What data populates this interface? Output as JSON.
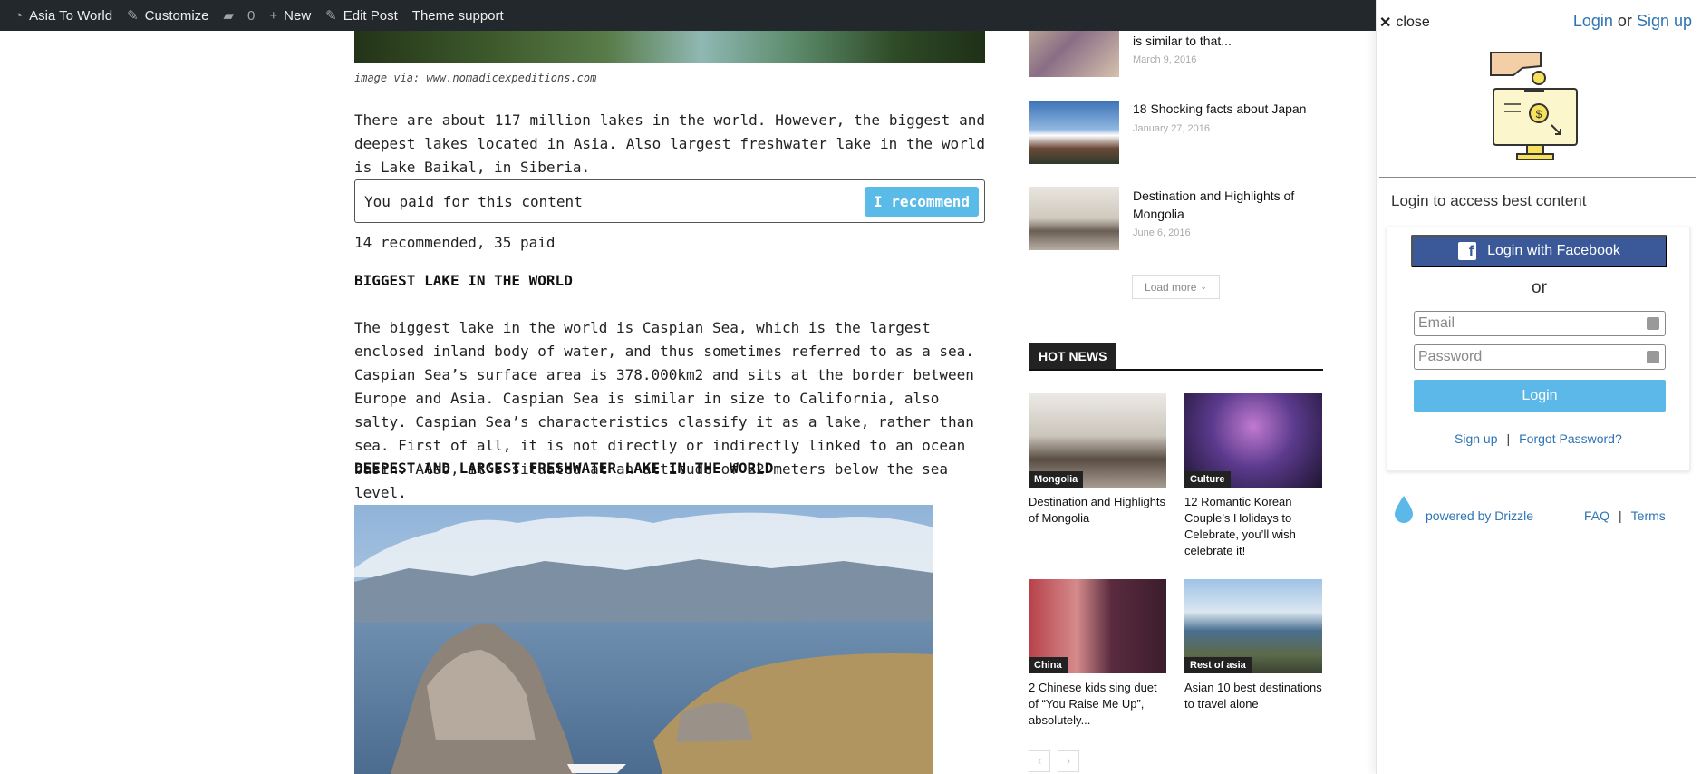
{
  "adminbar": {
    "site": "Asia To World",
    "customize": "Customize",
    "comments_count": "0",
    "new": "New",
    "edit_post": "Edit Post",
    "theme_support": "Theme support",
    "bg_color": "#23282d"
  },
  "article": {
    "image_caption": "image via: www.nomadicexpeditions.com",
    "intro": "There are about 117 million lakes in the world. However, the biggest and deepest lakes located in Asia. Also largest freshwater lake in the world is Lake Baikal, in Siberia.",
    "paywall_text": "You paid for this content",
    "recommend_button": "I recommend",
    "stats": "14 recommended, 35 paid",
    "heading_1": "BIGGEST LAKE IN THE WORLD",
    "paragraph_2": "The biggest lake in the world is Caspian Sea, which is the largest enclosed inland body of water, and thus sometimes referred to as a sea. Caspian Sea’s surface area is 378.000km2 and sits at the border between Europe and Asia. Caspian Sea is similar in size to California, also salty. Caspian Sea’s characteristics classify it as a lake, rather than sea. First of all, it is not directly or indirectly linked to an ocean basin. Also, it’s situated at an altitude of 22 meters below the sea level.",
    "heading_2": "DEEPEST AND LARGEST FRESHWATER LAKE IN THE WORLD",
    "accent_color": "#5bbbe8"
  },
  "sidebar": {
    "recent": [
      {
        "title": "is similar to that...",
        "date": "March 9, 2016"
      },
      {
        "title": "18 Shocking facts about Japan",
        "date": "January 27, 2016"
      },
      {
        "title": "Destination and Highlights of Mongolia",
        "date": "June 6, 2016"
      }
    ],
    "load_more": "Load more",
    "hot_news_label": "HOT NEWS",
    "cards": [
      {
        "category": "Mongolia",
        "title": "Destination and Highlights of Mongolia"
      },
      {
        "category": "Culture",
        "title": "12 Romantic Korean Couple’s Holidays to Celebrate, you’ll wish celebrate it!"
      },
      {
        "category": "China",
        "title": "2 Chinese kids sing duet of “You Raise Me Up”, absolutely..."
      },
      {
        "category": "Rest of asia",
        "title": "Asian 10 best destinations to travel alone"
      }
    ],
    "prev": "‹",
    "next": "›"
  },
  "panel": {
    "close": "close",
    "login_link": "Login",
    "or_text": "or",
    "signup_link": "Sign up",
    "subtitle": "Login to access best content",
    "facebook_button": "Login with Facebook",
    "or_divider": "or",
    "email_placeholder": "Email",
    "password_placeholder": "Password",
    "login_button": "Login",
    "signup": "Sign up",
    "forgot": "Forgot Password?",
    "powered_by": "powered by Drizzle",
    "faq": "FAQ",
    "terms": "Terms",
    "facebook_color": "#3b5998",
    "button_color": "#5cb8e8"
  }
}
